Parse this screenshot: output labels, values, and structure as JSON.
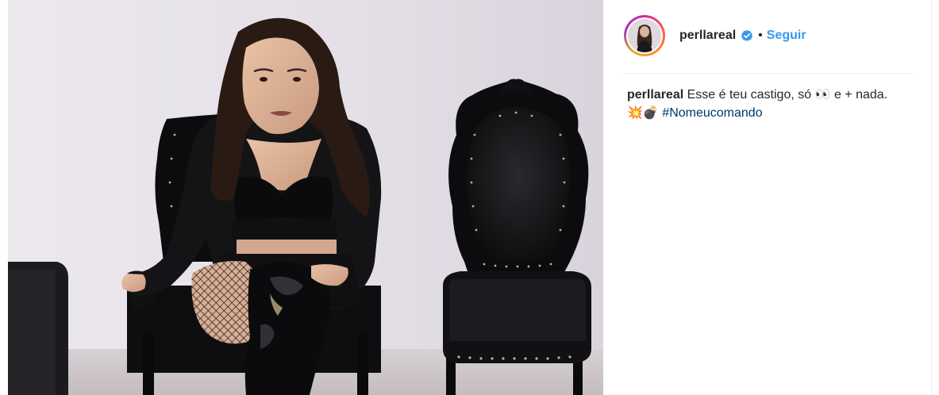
{
  "post": {
    "image_alt": "Photo: woman in black seated on a black tufted chair"
  },
  "header": {
    "username": "perllareal",
    "separator": "•",
    "follow_label": "Seguir"
  },
  "caption": {
    "username": "perllareal",
    "text": "Esse é teu castigo, só 👀 e + nada.",
    "emojis": "💥💣",
    "hashtag": "#Nomeucomando"
  },
  "colors": {
    "accent": "#3897f0",
    "hashtag": "#003569",
    "text": "#262626"
  }
}
